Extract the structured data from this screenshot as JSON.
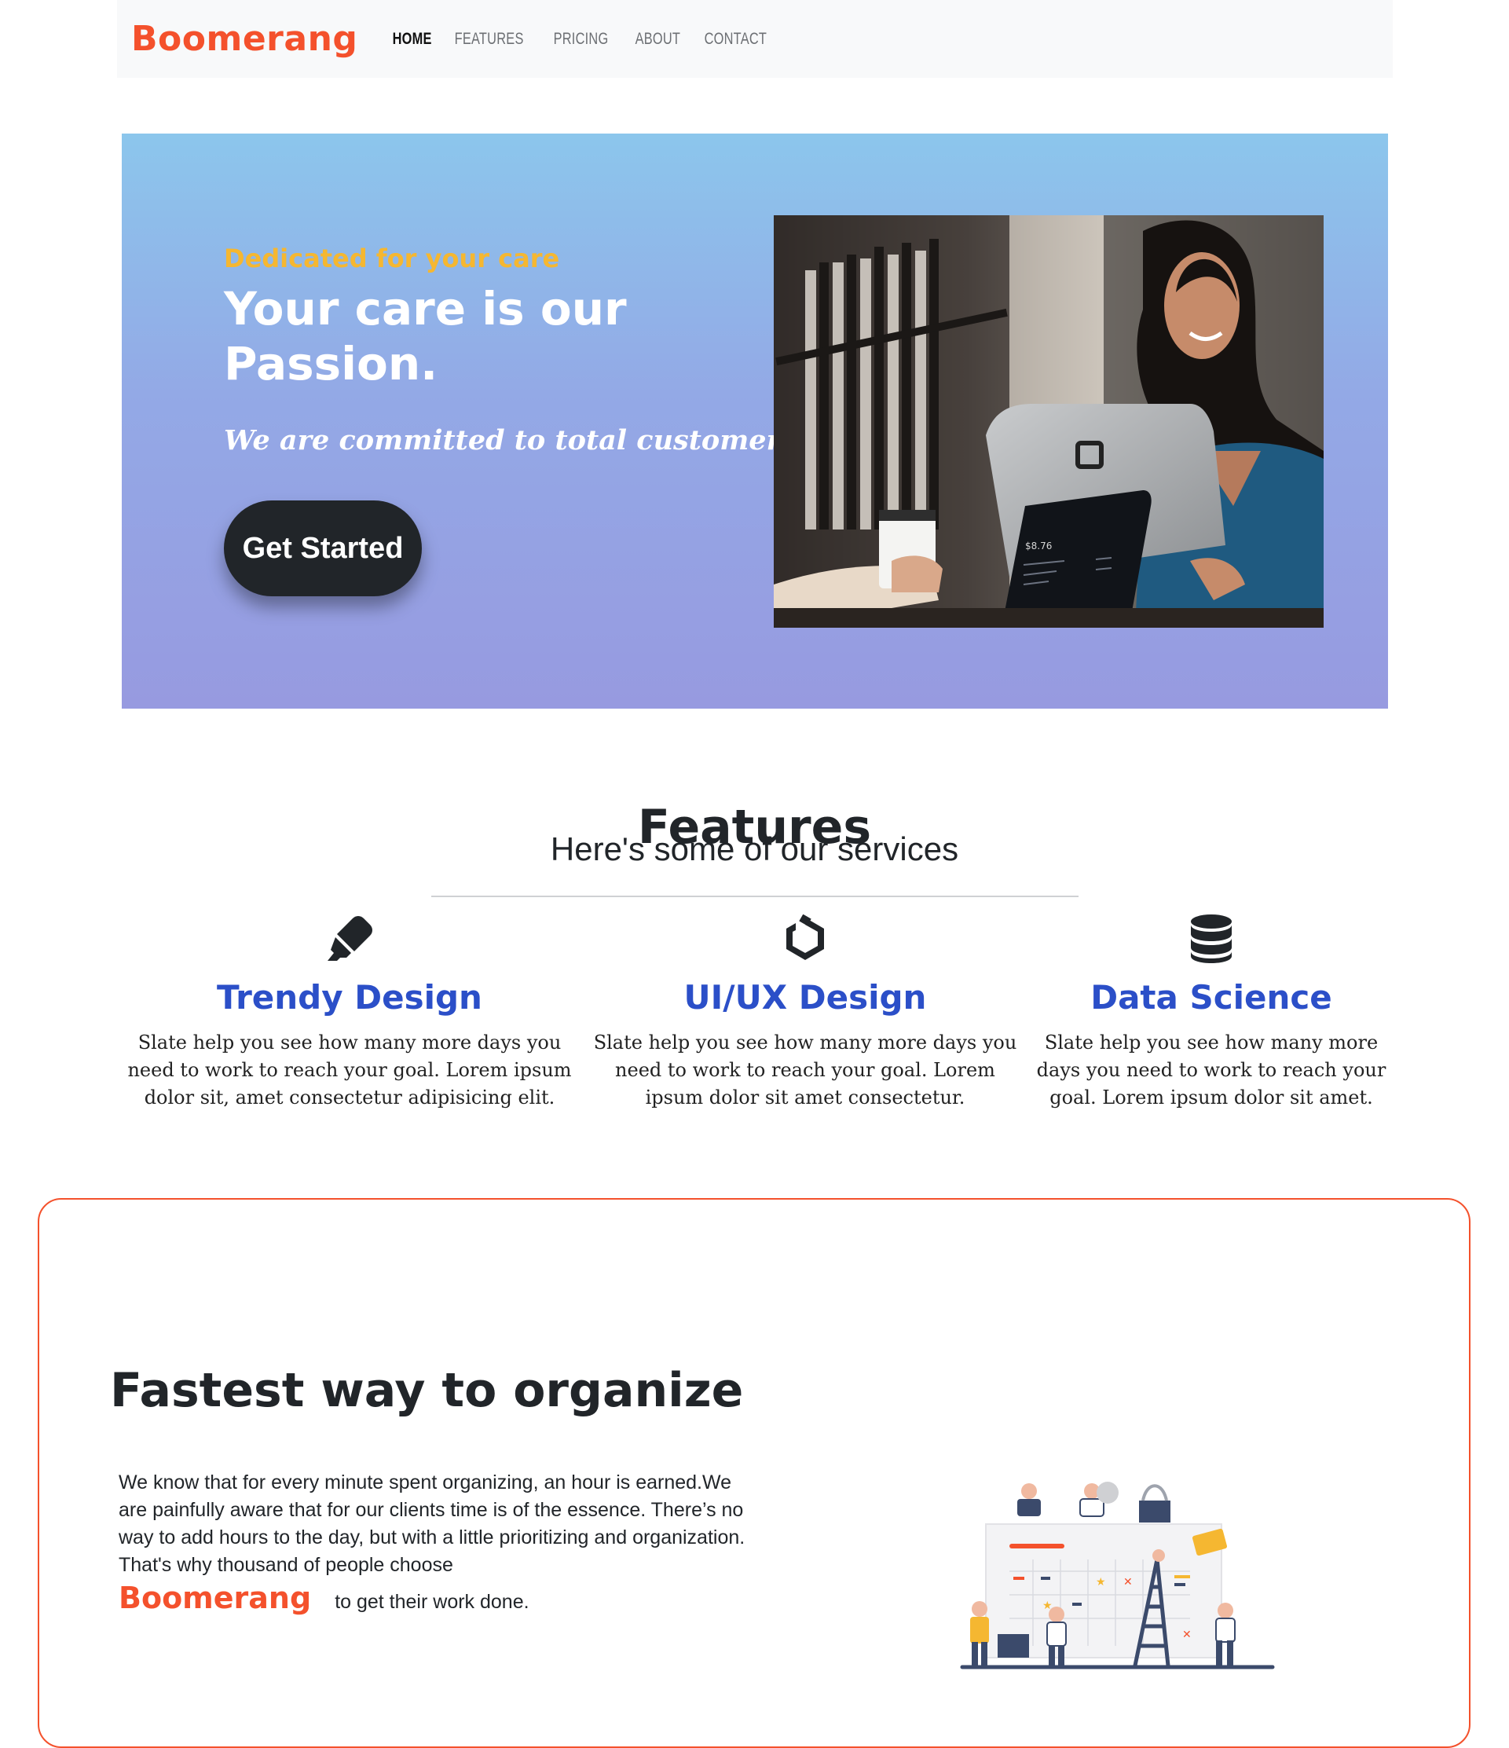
{
  "nav": {
    "brand": "Boomerang",
    "links": [
      "HOME",
      "FEATURES",
      "PRICING",
      "ABOUT",
      "CONTACT"
    ],
    "active": "HOME"
  },
  "hero": {
    "tagline": "Dedicated for your care",
    "title": "Your care is our Passion.",
    "subtitle": "We are committed to total customer service.",
    "cta_label": "Get Started",
    "image_alt": "Smiling woman using a tablet point-of-sale terminal",
    "pos_amount": "$8.76"
  },
  "features": {
    "title": "Features",
    "subtitle": "Here's some of our services",
    "items": [
      {
        "icon": "marker-icon",
        "title": "Trendy Design",
        "text": "Slate help you see how many more days you need to work to reach your goal. Lorem ipsum dolor sit, amet consectetur adipisicing elit."
      },
      {
        "icon": "uikit-icon",
        "title": "UI/UX Design",
        "text": "Slate help you see how many more days you need to work to reach your goal. Lorem ipsum dolor sit amet consectetur."
      },
      {
        "icon": "database-icon",
        "title": "Data Science",
        "text": "Slate help you see how many more days you need to work to reach your goal. Lorem ipsum dolor sit amet."
      }
    ]
  },
  "organize": {
    "title": "Fastest way to organize",
    "text": "We know that for every minute spent organizing, an hour is earned.We are painfully aware that for our clients time is of the essence. There’s no way to add hours to the day, but with a little prioritizing and organization. That's why thousand of people choose",
    "brand": "Boomerang",
    "suffix": "to get their work done."
  },
  "colors": {
    "brand": "#f4512c",
    "feature_title": "#2b4fc8",
    "tagline": "#f5b731",
    "button": "#212529"
  }
}
